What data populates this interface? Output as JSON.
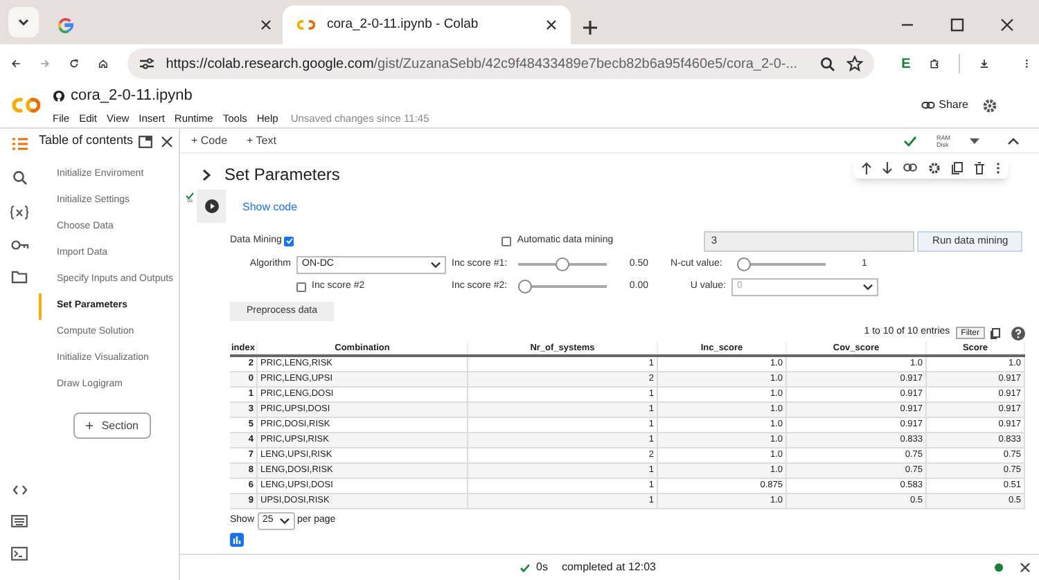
{
  "browser": {
    "tabs": [
      {
        "selected": false
      },
      {
        "title": "cora_2-0-11.ipynb - Colab",
        "selected": true
      }
    ],
    "url_host": "https://colab.research.google.com",
    "url_path": "/gist/ZuzanaSebb/42c9f48433489e7becb82b6a95f460e5/cora_2-0-...",
    "extension_label": "E"
  },
  "notebook": {
    "name": "cora_2-0-11.ipynb",
    "menu": [
      "File",
      "Edit",
      "View",
      "Insert",
      "Runtime",
      "Tools",
      "Help"
    ],
    "save_note": "Unsaved changes since 11:45",
    "share": "Share",
    "toolbar": [
      "+ Code",
      "+ Text"
    ],
    "ram_label": "RAM",
    "disk_label": "Disk"
  },
  "toc": {
    "title": "Table of contents",
    "items": [
      {
        "label": "Initialize Enviroment",
        "selected": false
      },
      {
        "label": "Initialize Settings",
        "selected": false
      },
      {
        "label": "Choose Data",
        "selected": false
      },
      {
        "label": "Import Data",
        "selected": false
      },
      {
        "label": "Specify Inputs and Outputs",
        "selected": false
      },
      {
        "label": "Set Parameters",
        "selected": true
      },
      {
        "label": "Compute Solution",
        "selected": false
      },
      {
        "label": "Initialize Visualization",
        "selected": false
      },
      {
        "label": "Draw Logigram",
        "selected": false
      }
    ],
    "section_button": "Section"
  },
  "cell": {
    "title": "Set Parameters",
    "show_code": "Show code",
    "run_status": "0s",
    "form": {
      "data_mining": {
        "label": "Data Mining",
        "checked": true
      },
      "automatic": {
        "label": "Automatic data mining",
        "checked": false
      },
      "text_value": "3",
      "run_button": "Run data mining",
      "algorithm": {
        "label": "Algorithm",
        "value": "ON-DC"
      },
      "inc1": {
        "label": "Inc score #1:",
        "level": 0.5,
        "reading": "0.50"
      },
      "ncut": {
        "label": "N-cut value:",
        "level": 0,
        "reading": "1"
      },
      "inc2_check": {
        "label": "Inc score #2",
        "checked": false
      },
      "inc2": {
        "label": "Inc score #2:",
        "level": 0,
        "reading": "0.00"
      },
      "u_value": {
        "label": "U value:",
        "value": "0",
        "disabled": true
      },
      "preprocess": "Preprocess data"
    },
    "table": {
      "info": "1 to 10 of 10 entries",
      "filter": "Filter",
      "columns": [
        "index",
        "Combination",
        "Nr_of_systems",
        "Inc_score",
        "Cov_score",
        "Score"
      ],
      "rows": [
        [
          "2",
          "PRIC,LENG,RISK",
          "1",
          "1.0",
          "1.0",
          "1.0"
        ],
        [
          "0",
          "PRIC,LENG,UPSI",
          "2",
          "1.0",
          "0.917",
          "0.917"
        ],
        [
          "1",
          "PRIC,LENG,DOSI",
          "1",
          "1.0",
          "0.917",
          "0.917"
        ],
        [
          "3",
          "PRIC,UPSI,DOSI",
          "1",
          "1.0",
          "0.917",
          "0.917"
        ],
        [
          "5",
          "PRIC,DOSI,RISK",
          "1",
          "1.0",
          "0.917",
          "0.917"
        ],
        [
          "4",
          "PRIC,UPSI,RISK",
          "1",
          "1.0",
          "0.833",
          "0.833"
        ],
        [
          "7",
          "LENG,UPSI,RISK",
          "2",
          "1.0",
          "0.75",
          "0.75"
        ],
        [
          "8",
          "LENG,DOSI,RISK",
          "1",
          "1.0",
          "0.75",
          "0.75"
        ],
        [
          "6",
          "LENG,UPSI,DOSI",
          "1",
          "0.875",
          "0.583",
          "0.51"
        ],
        [
          "9",
          "UPSI,DOSI,RISK",
          "1",
          "1.0",
          "0.5",
          "0.5"
        ]
      ],
      "show_label": "Show",
      "page_size": "25",
      "per_page": "per page"
    }
  },
  "status_bar": {
    "duration": "0s",
    "message": "completed at 12:03"
  }
}
